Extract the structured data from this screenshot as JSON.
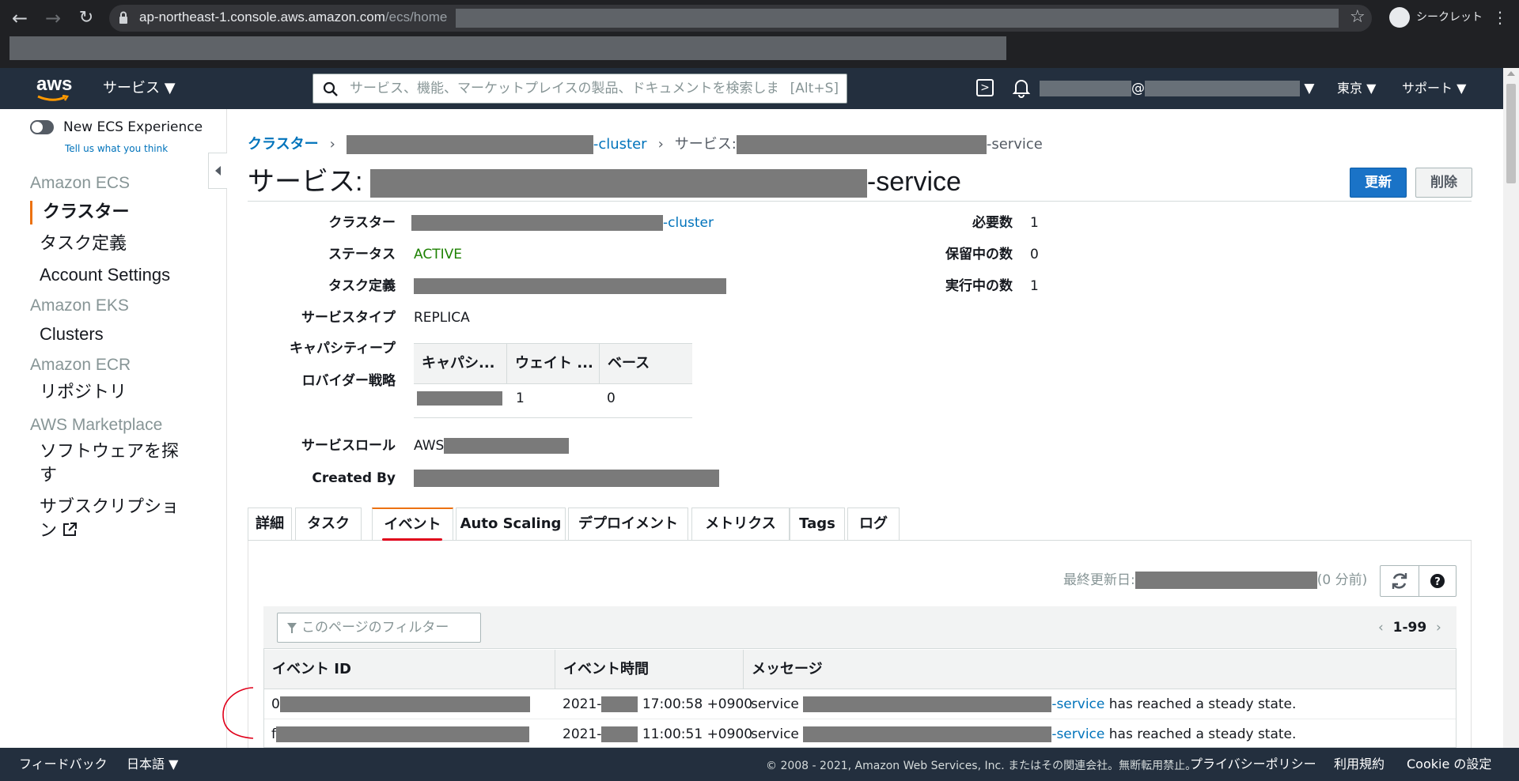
{
  "browser": {
    "url_host": "ap-northeast-1.console.aws.amazon.com",
    "url_path": "/ecs/home",
    "incognito_label": "シークレット",
    "icons": [
      "back-icon",
      "forward-icon",
      "reload-icon",
      "lock-icon",
      "star-icon",
      "incognito-icon",
      "kebab-icon"
    ]
  },
  "aws_header": {
    "logo": "aws",
    "services_label": "サービス ▼",
    "search_placeholder": "サービス、機能、マーケットプレイスの製品、ドキュメントを検索します",
    "search_shortcut": "[Alt+S]",
    "account_at": "@",
    "region": "東京 ▼",
    "support": "サポート ▼"
  },
  "sidebar": {
    "toggle_label": "New ECS Experience",
    "tell_us": "Tell us what you think",
    "sections": [
      {
        "heading": "Amazon ECS",
        "items": [
          "クラスター",
          "タスク定義",
          "Account Settings"
        ]
      },
      {
        "heading": "Amazon EKS",
        "items": [
          "Clusters"
        ]
      },
      {
        "heading": "Amazon ECR",
        "items": [
          "リポジトリ"
        ]
      },
      {
        "heading": "AWS Marketplace",
        "items": [
          "ソフトウェアを探",
          "す",
          "サブスクリプショ",
          "ン"
        ]
      }
    ],
    "active_item": "クラスター"
  },
  "breadcrumb": {
    "clusters": "クラスター",
    "cluster_suffix": "-cluster",
    "service_prefix": "サービス:",
    "service_suffix": "-service"
  },
  "page": {
    "title_prefix": "サービス:",
    "title_suffix": "-service",
    "update_button": "更新",
    "delete_button": "削除"
  },
  "details": {
    "cluster_label": "クラスター",
    "cluster_suffix": "-cluster",
    "status_label": "ステータス",
    "status_value": "ACTIVE",
    "taskdef_label": "タスク定義",
    "servicetype_label": "サービスタイプ",
    "servicetype_value": "REPLICA",
    "capacity_label_1": "キャパシティープ",
    "capacity_label_2": "ロバイダー戦略",
    "servicerole_label": "サービスロール",
    "servicerole_value": "AWS",
    "createdby_label": "Created By",
    "desired_label": "必要数",
    "desired_value": "1",
    "pending_label": "保留中の数",
    "pending_value": "0",
    "running_label": "実行中の数",
    "running_value": "1"
  },
  "capacity_table": {
    "headers": [
      "キャパシ...",
      "ウェイト ...",
      "ベース"
    ],
    "row": {
      "weight": "1",
      "base": "0"
    }
  },
  "tabs": [
    "詳細",
    "タスク",
    "イベント",
    "Auto Scaling",
    "デプロイメント",
    "メトリクス",
    "Tags",
    "ログ"
  ],
  "active_tab": "イベント",
  "events": {
    "last_updated_label": "最終更新日:",
    "last_updated_ago": "(0 分前)",
    "filter_placeholder": "このページのフィルター",
    "pager": "1-99",
    "headers": [
      "イベント ID",
      "イベント時間",
      "メッセージ"
    ],
    "rows": [
      {
        "id_prefix": "0",
        "time_prefix": "2021-",
        "time_suffix": "17:00:58 +0900",
        "msg_prefix": "service",
        "msg_link": "-service",
        "msg_suffix": "has reached a steady state."
      },
      {
        "id_prefix": "f",
        "time_prefix": "2021-",
        "time_suffix": "11:00:51 +0900",
        "msg_prefix": "service",
        "msg_link": "-service",
        "msg_suffix": "has reached a steady state."
      }
    ]
  },
  "footer": {
    "feedback": "フィードバック",
    "language": "日本語 ▼",
    "copyright": "© 2008 - 2021, Amazon Web Services, Inc. またはその関連会社。無断転用禁止。",
    "privacy": "プライバシーポリシー",
    "terms": "利用規約",
    "cookie": "Cookie の設定"
  },
  "colors": {
    "aws_header": "#232f3e",
    "link": "#0073bb",
    "accent": "#ec7211",
    "primary_button": "#1a73c7",
    "status_active": "#1d8102"
  }
}
